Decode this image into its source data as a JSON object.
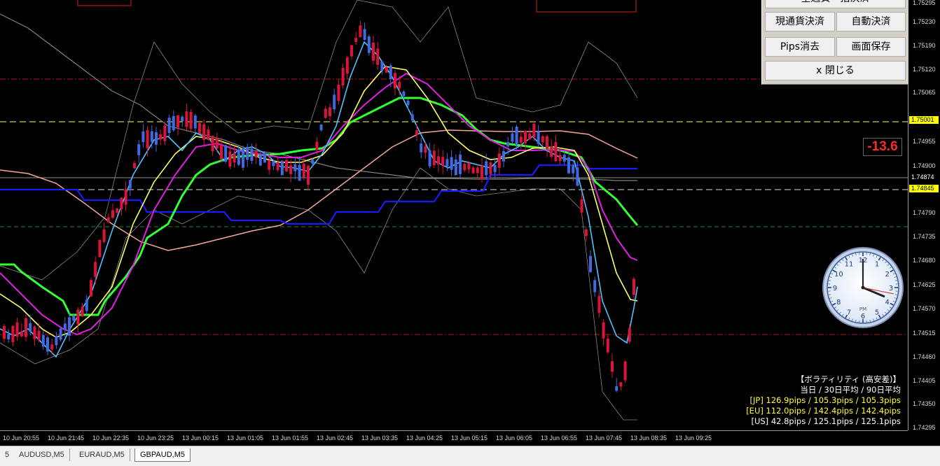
{
  "instrument": "GBPAUD,M5",
  "price_axis": {
    "ticks": [
      "1.75295",
      "1.75230",
      "1.75190",
      "1.75120",
      "1.75065",
      "1.75001",
      "1.74955",
      "1.74900",
      "1.74874",
      "1.74845",
      "1.74790",
      "1.74735",
      "1.74680",
      "1.74625",
      "1.74570",
      "1.74515",
      "1.74460",
      "1.74405",
      "1.74350",
      "1.74295"
    ],
    "current_price_flag": "1.75001",
    "bid_flag": "1.74845",
    "last_flag": "1.74874"
  },
  "time_axis": [
    "10 Jun 20:55",
    "10 Jun 21:45",
    "10 Jun 22:35",
    "10 Jun 23:25",
    "13 Jun 00:15",
    "13 Jun 01:05",
    "13 Jun 01:55",
    "13 Jun 02:45",
    "13 Jun 03:35",
    "13 Jun 04:25",
    "13 Jun 05:15",
    "13 Jun 06:05",
    "13 Jun 06:55",
    "13 Jun 07:45",
    "13 Jun 08:35",
    "13 Jun 09:25"
  ],
  "tabs": [
    "5",
    "AUDUSD,M5",
    "EURAUD,M5",
    "GBPAUD,M5"
  ],
  "active_tab": 3,
  "panel": {
    "top_partial": "全通貨一括決済",
    "btn_current_close": "現通貨決済",
    "btn_auto_close": "自動決済",
    "btn_pips_clear": "Pips消去",
    "btn_save_screen": "画面保存",
    "btn_close": "x 閉じる"
  },
  "spread_value": "-13.6",
  "volatility": {
    "title": "【ボラティリティ (高安差)】",
    "header": "当日 / 30日平均 / 90日平均",
    "jp": "[JP] 126.9pips / 105.3pips / 105.3pips",
    "eu": "[EU] 112.0pips / 142.4pips / 142.4pips",
    "us": "[US] 42.8pips / 125.1pips / 125.1pips"
  },
  "clock": {
    "label": "PM"
  },
  "colors": {
    "bull_candle": "#4169e1",
    "bear_candle": "#dc143c",
    "fast_ma": "#4fc3ff",
    "mid_ma": "#ffff66",
    "slow_ma": "#e020e0",
    "trend_line": "#33ff33",
    "support_line": "#1a1aff",
    "long_ma": "#f4a79b",
    "bands": "#888888",
    "yellow_dash": "#ffff66",
    "red_dash": "#b01818"
  }
}
